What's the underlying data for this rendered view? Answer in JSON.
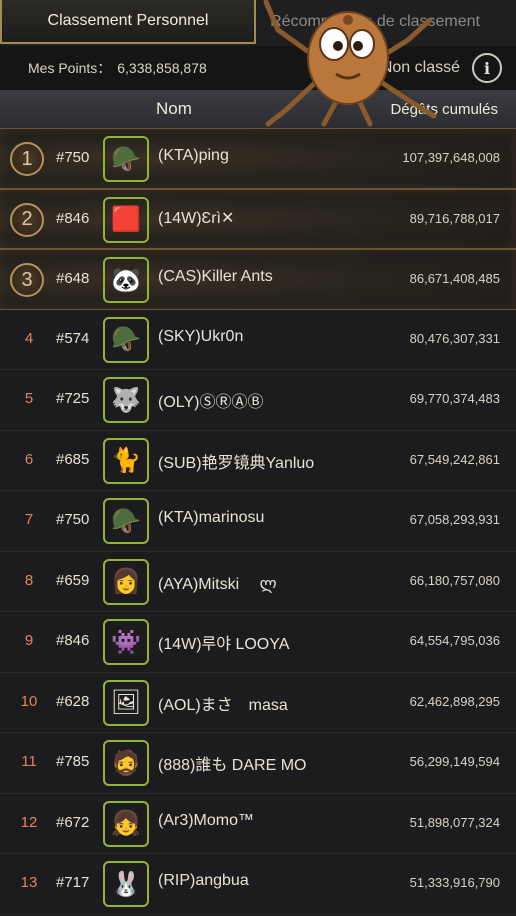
{
  "tabs": {
    "personal": "Classement Personnel",
    "other": "Récompenses de classement"
  },
  "points": {
    "label": "Mes Points：",
    "value": "6,338,858,878",
    "status": "Non classé",
    "info_glyph": "i"
  },
  "header": {
    "name": "Nom",
    "damage": "Dégâts cumulés"
  },
  "rows": [
    {
      "rank": "1",
      "server": "#750",
      "player": "(KTA)ping",
      "damage": "107,397,648,008",
      "avatar": "🪖"
    },
    {
      "rank": "2",
      "server": "#846",
      "player": "(14W)Ɛrì✕",
      "damage": "89,716,788,017",
      "avatar": "🟥"
    },
    {
      "rank": "3",
      "server": "#648",
      "player": "(CAS)Killer Ants",
      "damage": "86,671,408,485",
      "avatar": "🐼"
    },
    {
      "rank": "4",
      "server": "#574",
      "player": "(SKY)Ukr0n",
      "damage": "80,476,307,331",
      "avatar": "🪖"
    },
    {
      "rank": "5",
      "server": "#725",
      "player": "(OLY)ⓈⓇⒶⒷ",
      "damage": "69,770,374,483",
      "avatar": "🐺"
    },
    {
      "rank": "6",
      "server": "#685",
      "player": "(SUB)艳罗镜典Yanluo",
      "damage": "67,549,242,861",
      "avatar": "🐈"
    },
    {
      "rank": "7",
      "server": "#750",
      "player": "(KTA)marinosu",
      "damage": "67,058,293,931",
      "avatar": "🪖"
    },
    {
      "rank": "8",
      "server": "#659",
      "player": "(AYA)Mitski　 ლ",
      "damage": "66,180,757,080",
      "avatar": "👩"
    },
    {
      "rank": "9",
      "server": "#846",
      "player": "(14W)루야 LOOYA",
      "damage": "64,554,795,036",
      "avatar": "👾"
    },
    {
      "rank": "10",
      "server": "#628",
      "player": "(AOL)まさ　masa",
      "damage": "62,462,898,295",
      "avatar": "🖼"
    },
    {
      "rank": "11",
      "server": "#785",
      "player": "(888)誰も DARE MO",
      "damage": "56,299,149,594",
      "avatar": "🧔"
    },
    {
      "rank": "12",
      "server": "#672",
      "player": "(Ar3)Momo™",
      "damage": "51,898,077,324",
      "avatar": "👧"
    },
    {
      "rank": "13",
      "server": "#717",
      "player": "(RIP)angbua",
      "damage": "51,333,916,790",
      "avatar": "🐰"
    }
  ]
}
